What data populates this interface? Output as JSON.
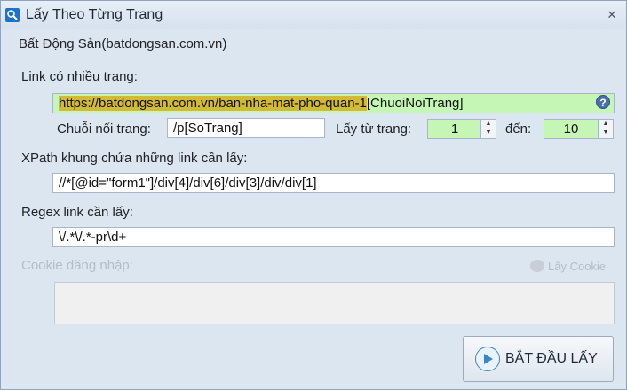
{
  "window": {
    "title": "Lấy Theo Từng Trang",
    "close_glyph": "✕"
  },
  "site_name": "Bất Động Sản(batdongsan.com.vn)",
  "link": {
    "label": "Link có nhiều trang:",
    "url_part": "https://batdongsan.com.vn/ban-nha-mat-pho-quan-1",
    "token_part": "[ChuoiNoiTrang]",
    "help_glyph": "?"
  },
  "paging": {
    "join_label": "Chuỗi nối trang:",
    "join_value": "/p[SoTrang]",
    "from_label": "Lấy từ trang:",
    "from_value": "1",
    "to_label": "đến:",
    "to_value": "10"
  },
  "xpath": {
    "label": "XPath khung chứa những link cần lấy:",
    "value": "//*[@id=\"form1\"]/div[4]/div[6]/div[3]/div/div[1]"
  },
  "regex": {
    "label": "Regex link cần lấy:",
    "value": "\\/.*\\/.*-pr\\d+"
  },
  "cookie": {
    "label": "Cookie đăng nhập:",
    "button_label": "Lấy Cookie",
    "value": ""
  },
  "start_button": {
    "label": "BẮT ĐẦU LẤY"
  },
  "colors": {
    "accent_green": "#c6f6b6",
    "highlight": "#d2ba35",
    "window_bg": "#dce6f1"
  }
}
